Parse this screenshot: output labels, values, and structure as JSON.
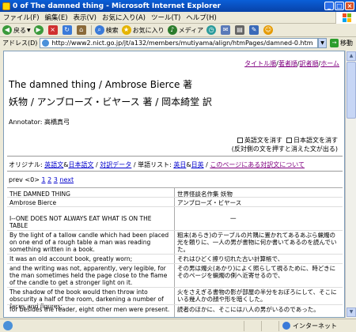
{
  "window": {
    "title": "0 of The damned thing - Microsoft Internet Explorer"
  },
  "menu": [
    "ファイル(F)",
    "編集(E)",
    "表示(V)",
    "お気に入り(A)",
    "ツール(T)",
    "ヘルプ(H)"
  ],
  "toolbar": {
    "back": "戻る",
    "search": "検索",
    "favorites": "お気に入り",
    "media": "メディア"
  },
  "address": {
    "label": "アドレス(D)",
    "url": "http://www2.nict.go.jp/jt/a132/members/mutiyama/align/htmPages/damned-0.htm",
    "go": "移動"
  },
  "page": {
    "toplinks": {
      "titles": "タイトル順",
      "authors": "著者順",
      "translators": "訳者順",
      "home": "ホーム"
    },
    "title_en": "The damned thing / Ambrose Bierce 著",
    "title_ja": "妖物 / アンブローズ・ビヤース 著 / 岡本綺堂 訳",
    "annotator": "Annotator: 高橋真弓",
    "check_en": "英語文を消す",
    "check_ja": "日本語文を消す",
    "check_note": "(反対側の文を押すと消えた文が出る)",
    "original_prefix": "オリジナル:",
    "orig_en": "英語文",
    "orig_amp1": "&",
    "orig_ja": "日本語文",
    "orig_sep1": "/",
    "parallel_data": "対訳データ",
    "orig_sep2": "/ 単語リスト:",
    "word_en": "英日",
    "word_amp2": "&",
    "word_ja": "日英",
    "orig_sep3": "/",
    "about": "このページにある対訳文について",
    "pager": {
      "prev": "prev",
      "current": "<0>",
      "p1": "1",
      "p2": "2",
      "p3": "3",
      "next": "next"
    },
    "rows": [
      {
        "en": "THE DAMNED THING",
        "ja": "世界怪談名作集 妖物"
      },
      {
        "en": "Ambrose Bierce",
        "ja": "アンブローズ・ビヤース"
      },
      {
        "en": "",
        "ja": "一"
      },
      {
        "en": "I--ONE DOES NOT ALWAYS EAT WHAT IS ON THE TABLE",
        "ja": ""
      },
      {
        "en": "By the light of a tallow candle which had been placed on one end of a rough table a man was reading something written in a book.",
        "ja": "粗末(あらき)のテーブルの片隅に置かれてあるあぶら蝋燭の光を頼りに、一人の男が書物に何か書いてあるのを読んでいた。"
      },
      {
        "en": "It was an old account book, greatly worn;",
        "ja": "それはひどく擦り切れた古い計算帳で、"
      },
      {
        "en": "and the writing was not, apparently, very legible, for the man sometimes held the page close to the flame of the candle to get a stronger light on it.",
        "ja": "その男は燭火(あかり)によく照らして視るために、時どきにそのページを蝋燭の側へ近寄せるので、"
      },
      {
        "en": "The shadow of the book would then throw into obscurity a half of the room, darkening a number of faces and figures;",
        "ja": "火をさえぎる書物の影が部屋の半分をおぼろにして、そこにいる幾人かの顔や形を暗くした。"
      },
      {
        "en": "for besides the reader, eight other men were present.",
        "ja": "読者のほかに、そこには八人の男がいるのであった。"
      }
    ]
  },
  "status": {
    "text": "インターネット"
  }
}
